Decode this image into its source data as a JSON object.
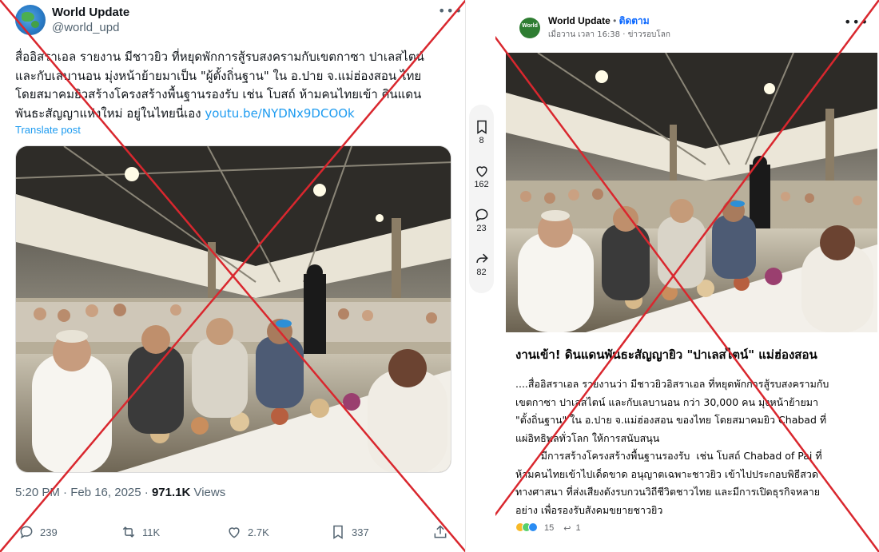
{
  "left_post": {
    "name": "World Update",
    "handle": "@world_upd",
    "text_lines": [
      "สื่ออิสราเอล รายงาน มีชาวยิว ที่หยุดพักการสู้รบสงครามกับเขตกาซา ปาเลสไตน์",
      "และกับเลบานอน มุ่งหน้าย้ายมาเป็น \"ผู้ตั้งถิ่นฐาน\" ใน อ.ปาย จ.แม่ฮ่องสอน ไทย",
      "โดยสมาคมยิวสร้างโครงสร้างพื้นฐานรองรับ  เช่น โบสถ์ ห้ามคนไทยเข้า ดินแดน",
      "พันธะสัญญาแห่งใหม่ อยู่ในไทยนี่เอง "
    ],
    "link": "youtu.be/NYDNx9DCOOk",
    "translate_label": "Translate post",
    "time": "5:20 PM · Feb 16, 2025 · ",
    "views_count": "971.1K",
    "views_label": " Views",
    "actions": {
      "replies": "239",
      "reposts": "11K",
      "likes": "2.7K",
      "bookmarks": "337"
    }
  },
  "rail": {
    "bookmarks": "8",
    "likes": "162",
    "comments": "23",
    "shares": "82"
  },
  "right_post": {
    "page_name": "World Update",
    "dot": " • ",
    "follow": "ติดตาม",
    "avatar_text": "World",
    "sub": "เมื่อวาน เวลา 16:38 · ข่าวรอบโลก",
    "title": "งานเข้า! ดินแดนพันธะสัญญายิว \"ปาเลสไตน์\" แม่ฮ่องสอน",
    "body_lines": [
      "....สื่ออิสราเอล รายงานว่า มีชาวยิวอิสราเอล ที่หยุดพักการสู้รบสงครามกับ",
      "เขตกาซา ปาเลสไตน์ และกับเลบานอน กว่า 30,000 คน มุ่งหน้าย้ายมา",
      "\"ตั้งถิ่นฐาน\" ใน อ.ปาย จ.แม่ฮ่องสอน ของไทย โดยสมาคมยิว Chabad ที่",
      "แผ่อิทธิพลทั่วโลก ให้การสนับสนุน",
      "        มีการสร้างโครงสร้างพื้นฐานรองรับ  เช่น โบสถ์ Chabad of Pai ที่",
      "ห้ามคนไทยเข้าไปเด็ดขาด อนุญาตเฉพาะชาวยิว เข้าไปประกอบพิธีสวด",
      "ทางศาสนา ที่ส่งเสียงดังรบกวนวิถีชีวิตชาวไทย และมีการเปิดธุรกิจหลาย",
      "อย่าง เพื่อรองรับสังคมขยายชาวยิว"
    ],
    "reactions": "15",
    "shares": "1"
  },
  "colors": {
    "x_mark": "#d9272e",
    "twitter_link": "#1d9bf0",
    "fb_follow": "#0866ff"
  }
}
